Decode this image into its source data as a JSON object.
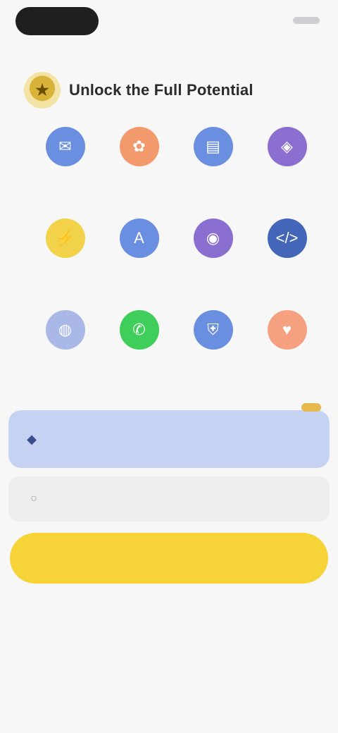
{
  "top_bar": {
    "pill_text": "",
    "right_text": ""
  },
  "header": {
    "title": "Unlock the Full Potential",
    "logo_glyph": "★"
  },
  "features": [
    {
      "label": "",
      "icon": "chat-icon",
      "color": "#6b8fe0",
      "glyph": "✉"
    },
    {
      "label": "",
      "icon": "image-icon",
      "color": "#f29a6b",
      "glyph": "✿"
    },
    {
      "label": "",
      "icon": "document-icon",
      "color": "#6b8fe0",
      "glyph": "▤"
    },
    {
      "label": "",
      "icon": "brain-icon",
      "color": "#8a6fd0",
      "glyph": "◈"
    },
    {
      "label": "",
      "icon": "lightning-icon",
      "color": "#f2d24a",
      "glyph": "⚡"
    },
    {
      "label": "",
      "icon": "translate-icon",
      "color": "#6b8fe0",
      "glyph": "A"
    },
    {
      "label": "",
      "icon": "microphone-icon",
      "color": "#8a6fd0",
      "glyph": "◉"
    },
    {
      "label": "",
      "icon": "code-icon",
      "color": "#4466b8",
      "glyph": "</>"
    },
    {
      "label": "",
      "icon": "globe-icon",
      "color": "#a9b8e6",
      "glyph": "◍"
    },
    {
      "label": "",
      "icon": "whatsapp-icon",
      "color": "#3fce5a",
      "glyph": "✆"
    },
    {
      "label": "",
      "icon": "shield-icon",
      "color": "#6b8fe0",
      "glyph": "⛨"
    },
    {
      "label": "",
      "icon": "heart-icon",
      "color": "#f5a07f",
      "glyph": "♥"
    }
  ],
  "promo": {
    "title": "",
    "subtitle": "",
    "right_text": "",
    "badge": "",
    "icon_glyph": "◆"
  },
  "info_row": {
    "label": "",
    "value": "",
    "icon_glyph": "○"
  },
  "cta": {
    "label": ""
  },
  "disclaimer": "",
  "links": {
    "primary": "",
    "secondary": ""
  },
  "footer": ""
}
